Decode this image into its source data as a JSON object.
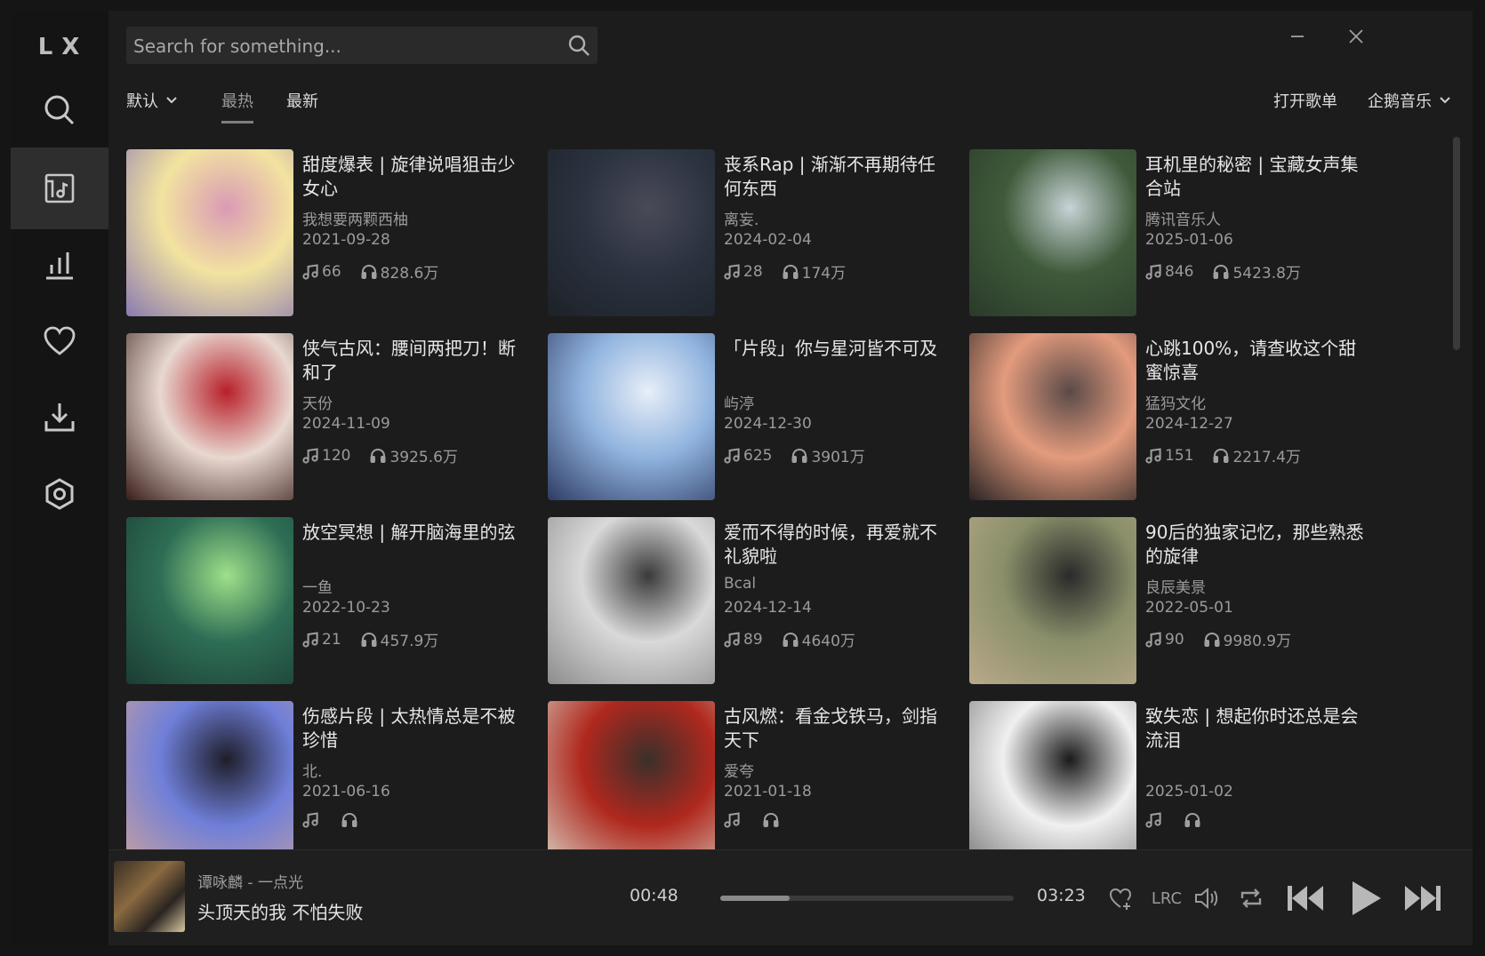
{
  "app": {
    "logo": "LX"
  },
  "colors": {
    "background": "#1c1c1c",
    "sidebar": "#141414",
    "active_nav": "#2e2e2e",
    "text": "#e6e6e6",
    "muted": "#9b9b9b"
  },
  "sidebar": {
    "items": [
      {
        "name": "search",
        "icon": "search-icon"
      },
      {
        "name": "songlist",
        "icon": "playlist-icon",
        "active": true
      },
      {
        "name": "leaderboard",
        "icon": "bar-chart-icon"
      },
      {
        "name": "favorites",
        "icon": "heart-icon"
      },
      {
        "name": "download",
        "icon": "download-icon"
      },
      {
        "name": "settings",
        "icon": "settings-icon"
      }
    ]
  },
  "search": {
    "placeholder": "Search for something..."
  },
  "toolbar": {
    "sort_label": "默认",
    "tab_hot": "最热",
    "tab_new": "最新",
    "open_list": "打开歌单",
    "source": "企鹅音乐"
  },
  "playlists": [
    {
      "title": "甜度爆表 | 旋律说唱狙击少女心",
      "author": "我想要两颗西柚",
      "date": "2021-09-28",
      "songs": "66",
      "plays": "828.6万",
      "cover_colors": [
        "#f3e3a0",
        "#d99bb5",
        "#8a7ab0"
      ]
    },
    {
      "title": "丧系Rap | 渐渐不再期待任何东西",
      "author": "离妄.",
      "date": "2024-02-04",
      "songs": "28",
      "plays": "174万",
      "cover_colors": [
        "#2b3340",
        "#4a4a58",
        "#1d2128"
      ]
    },
    {
      "title": "耳机里的秘密 | 宝藏女声集合站",
      "author": "腾讯音乐人",
      "date": "2025-01-06",
      "songs": "846",
      "plays": "5423.8万",
      "cover_colors": [
        "#3f5a3a",
        "#c7d3d6",
        "#2a3a2a"
      ]
    },
    {
      "title": "侠气古风：腰间两把刀！断和了",
      "author": "天份",
      "date": "2024-11-09",
      "songs": "120",
      "plays": "3925.6万",
      "cover_colors": [
        "#e8d8d0",
        "#b8202a",
        "#3a1d1a"
      ]
    },
    {
      "title": "「片段」你与星河皆不可及",
      "author": "屿渟",
      "date": "2024-12-30",
      "songs": "625",
      "plays": "3901万",
      "cover_colors": [
        "#8fb3de",
        "#e7eef8",
        "#2e3b63"
      ]
    },
    {
      "title": "心跳100%，请查收这个甜蜜惊喜",
      "author": "猛犸文化",
      "date": "2024-12-27",
      "songs": "151",
      "plays": "2217.4万",
      "cover_colors": [
        "#e39b7d",
        "#5a4a48",
        "#2a2424"
      ]
    },
    {
      "title": "放空冥想 | 解开脑海里的弦",
      "author": "一鱼",
      "date": "2022-10-23",
      "songs": "21",
      "plays": "457.9万",
      "cover_colors": [
        "#2e6e55",
        "#9fe08a",
        "#1b3c33"
      ]
    },
    {
      "title": "爱而不得的时候，再爱就不礼貌啦",
      "author": "Bcal",
      "date": "2024-12-14",
      "songs": "89",
      "plays": "4640万",
      "cover_colors": [
        "#d9d9d9",
        "#3a3a3a",
        "#8c8c8c"
      ]
    },
    {
      "title": "90后的独家记忆，那些熟悉的旋律",
      "author": "良辰美景",
      "date": "2022-05-01",
      "songs": "90",
      "plays": "9980.9万",
      "cover_colors": [
        "#8a8f6a",
        "#2a2a2a",
        "#b9a98a"
      ]
    },
    {
      "title": "伤感片段 | 太热情总是不被珍惜",
      "author": "北.",
      "date": "2021-06-16",
      "songs": "",
      "plays": "",
      "cover_colors": [
        "#6f7fd8",
        "#1e1e2a",
        "#c9a0a0"
      ]
    },
    {
      "title": "古风燃：看金戈铁马，剑指天下",
      "author": "爱夸",
      "date": "2021-01-18",
      "songs": "",
      "plays": "",
      "cover_colors": [
        "#b0281e",
        "#3a302a",
        "#d7cfc0"
      ]
    },
    {
      "title": "致失恋 | 想起你时还总是会流泪",
      "author": "",
      "date": "2025-01-02",
      "songs": "",
      "plays": "",
      "cover_colors": [
        "#f0f0f0",
        "#1a1a1a",
        "#7a7a7a"
      ]
    }
  ],
  "player": {
    "artist_track": "谭咏麟 - 一点光",
    "lyric": "头顶天的我 不怕失败",
    "current_time": "00:48",
    "total_time": "03:23",
    "progress": 0.236,
    "lrc_label": "LRC"
  }
}
